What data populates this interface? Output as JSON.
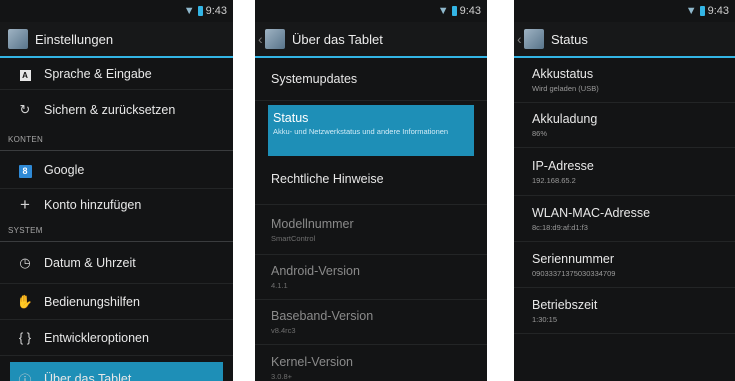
{
  "status_bar": {
    "time": "9:43"
  },
  "colors": {
    "accent": "#33b5e5",
    "selected": "#1e8fb7",
    "background": "#131415"
  },
  "screen1": {
    "title": "Einstellungen",
    "items": [
      {
        "label": "Sprache & Eingabe",
        "icon": "keyboard-icon"
      },
      {
        "label": "Sichern & zurücksetzen",
        "icon": "restore-icon"
      },
      {
        "header": "KONTEN"
      },
      {
        "label": "Google",
        "icon": "google-icon"
      },
      {
        "label": "Konto hinzufügen",
        "icon": "plus-icon"
      },
      {
        "header": "SYSTEM"
      },
      {
        "label": "Datum & Uhrzeit",
        "icon": "clock-icon"
      },
      {
        "label": "Bedienungshilfen",
        "icon": "hand-icon"
      },
      {
        "label": "Entwickleroptionen",
        "icon": "braces-icon"
      },
      {
        "label": "Über das Tablet",
        "icon": "info-icon",
        "selected": true
      }
    ]
  },
  "screen2": {
    "title": "Über das Tablet",
    "items": [
      {
        "title": "Systemupdates"
      },
      {
        "title": "Status",
        "subtitle": "Akku- und Netzwerkstatus und andere Informationen",
        "selected": true
      },
      {
        "title": "Rechtliche Hinweise"
      },
      {
        "title": "Modellnummer",
        "subtitle": "SmartControl"
      },
      {
        "title": "Android-Version",
        "subtitle": "4.1.1"
      },
      {
        "title": "Baseband-Version",
        "subtitle": "v8.4rc3"
      },
      {
        "title": "Kernel-Version",
        "subtitle": "3.0.8+"
      }
    ]
  },
  "screen3": {
    "title": "Status",
    "items": [
      {
        "title": "Akkustatus",
        "value": "Wird geladen (USB)"
      },
      {
        "title": "Akkuladung",
        "value": "86%"
      },
      {
        "title": "IP-Adresse",
        "value": "192.168.65.2"
      },
      {
        "title": "WLAN-MAC-Adresse",
        "value": "8c:18:d9:af:d1:f3"
      },
      {
        "title": "Seriennummer",
        "value": "09033371375030334709"
      },
      {
        "title": "Betriebszeit",
        "value": "1:30:15"
      }
    ]
  }
}
